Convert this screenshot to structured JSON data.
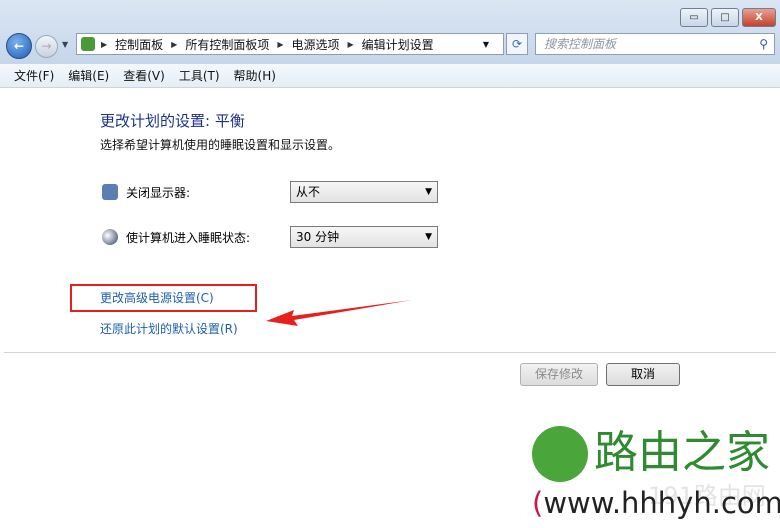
{
  "window": {
    "minimize": "▭",
    "maximize": "□",
    "close": "X"
  },
  "nav": {
    "back": "←",
    "forward": "→",
    "breadcrumb": [
      "控制面板",
      "所有控制面板项",
      "电源选项",
      "编辑计划设置"
    ],
    "refresh": "⟳",
    "search_placeholder": "搜索控制面板",
    "icons": {
      "back": "back-arrow-icon",
      "search": "magnifier-icon"
    }
  },
  "menu": [
    "文件(F)",
    "编辑(E)",
    "查看(V)",
    "工具(T)",
    "帮助(H)"
  ],
  "main": {
    "title": "更改计划的设置: 平衡",
    "subtitle": "选择希望计算机使用的睡眠设置和显示设置。",
    "display_label": "关闭显示器:",
    "display_value": "从不",
    "sleep_label": "使计算机进入睡眠状态:",
    "sleep_value": "30 分钟",
    "advanced_link": "更改高级电源设置(C)",
    "restore_link": "还原此计划的默认设置(R)",
    "save": "保存修改",
    "cancel": "取消"
  },
  "annotation_color": "#e8201c",
  "watermark": {
    "brand": "路由之家",
    "url": "(www.hhhyh.com)",
    "faint": "191路由网"
  }
}
